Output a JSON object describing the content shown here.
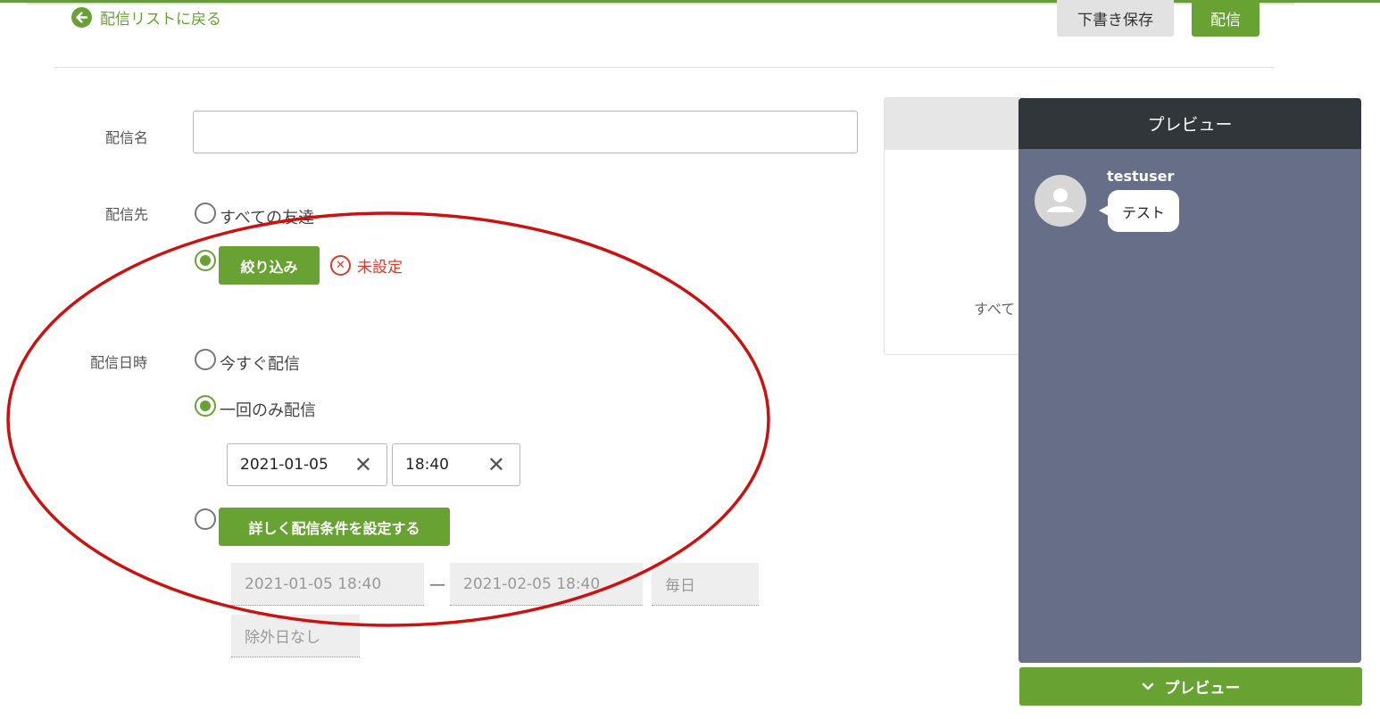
{
  "header": {
    "back_label": "配信リストに戻る",
    "draft_label": "下書き保存",
    "send_label": "配信"
  },
  "form": {
    "name_label": "配信名",
    "name_value": "",
    "target_label": "配信先",
    "target_all_label": "すべての友達",
    "filter_button_label": "絞り込み",
    "filter_status": "未設定",
    "datetime_label": "配信日時",
    "now_label": "今すぐ配信",
    "once_label": "一回のみ配信",
    "date_value": "2021-01-05",
    "time_value": "18:40",
    "detail_button_label": "詳しく配信条件を設定する",
    "range_start": "2021-01-05 18:40",
    "range_sep": "—",
    "range_end": "2021-02-05 18:40",
    "repeat": "毎日",
    "exclude": "除外日なし"
  },
  "side_card": {
    "text": "すべて"
  },
  "preview": {
    "title": "プレビュー",
    "username": "testuser",
    "message": "テスト",
    "toggle_label": "プレビュー"
  },
  "colors": {
    "accent": "#67a233",
    "error": "#d93b2b",
    "preview_bg": "#666f87",
    "preview_header": "#31363b",
    "annotation": "#cc1111"
  }
}
